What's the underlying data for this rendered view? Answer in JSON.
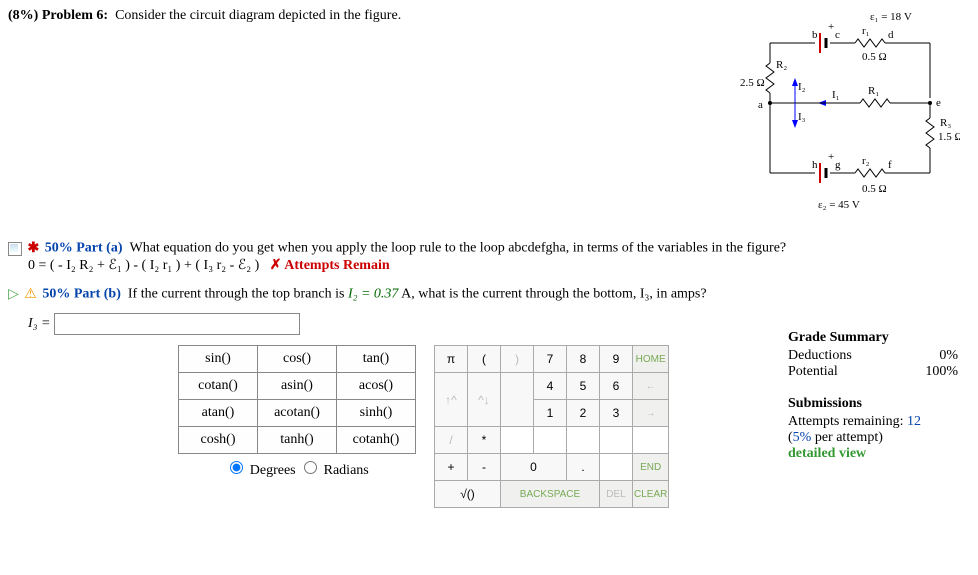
{
  "header": {
    "percent": "(8%)",
    "label": "Problem 6:",
    "text": "Consider the circuit diagram depicted in the figure."
  },
  "fig": {
    "e1": "ε₁ = 18 V",
    "e2": "ε₂ = 45 V",
    "r1_top": "r₁",
    "r1_top_val": "0.5 Ω",
    "r2": "R₂",
    "r2_val": "2.5 Ω",
    "I1": "I₁",
    "I2": "I₂",
    "I3": "I₃",
    "R1": "R₁",
    "R3": "R₃",
    "R3_val": "1.5 Ω",
    "r2_bot": "r₂",
    "r2_bot_val": "0.5 Ω",
    "a": "a",
    "b": "b",
    "c": "c",
    "d": "d",
    "e": "e",
    "f": "f",
    "g": "g",
    "h": "h",
    "plus": "+"
  },
  "partA": {
    "pct": "50% Part (a)",
    "q": "What equation do you get when you apply the loop rule to the loop abcdefgha, in terms of the variables in the figure?",
    "ans": "0 = ( - I₂ R₂ + ℰ₁ ) - ( I₂ r₁ ) + ( I₃ r₂ - ℰ₂ )",
    "attempts": "✗ Attempts Remain"
  },
  "partB": {
    "pct": "50% Part (b)",
    "q_pre": "If the current through the top branch is ",
    "q_val": "I₂ = 0.37",
    "q_post": " A, what is the current through the bottom, I₃, in amps?",
    "label": "I₃ = "
  },
  "funcs": [
    [
      "sin()",
      "cos()",
      "tan()"
    ],
    [
      "cotan()",
      "asin()",
      "acos()"
    ],
    [
      "atan()",
      "acotan()",
      "sinh()"
    ],
    [
      "cosh()",
      "tanh()",
      "cotanh()"
    ]
  ],
  "mode": {
    "deg": "Degrees",
    "rad": "Radians"
  },
  "nums": {
    "pi": "π",
    "lp": "(",
    "rp": ")",
    "n7": "7",
    "n8": "8",
    "n9": "9",
    "home": "HOME",
    "up": "↑^",
    "dn": "^↓",
    "n4": "4",
    "n5": "5",
    "n6": "6",
    "left": "←",
    "sl": "/",
    "st": "*",
    "n1": "1",
    "n2": "2",
    "n3": "3",
    "right": "→",
    "pl": "+",
    "mi": "-",
    "n0": "0",
    "dot": ".",
    "end": "END",
    "sq": "√()",
    "bk": "BACKSPACE",
    "del": "DEL",
    "cl": "CLEAR"
  },
  "grade": {
    "title": "Grade Summary",
    "deductions": "Deductions",
    "ded_val": "0%",
    "potential": "Potential",
    "pot_val": "100%",
    "subs": "Submissions",
    "attempts": "Attempts remaining: ",
    "att_val": "12",
    "per": "(5% per attempt)",
    "per_pct": "5%",
    "detail": "detailed view"
  }
}
